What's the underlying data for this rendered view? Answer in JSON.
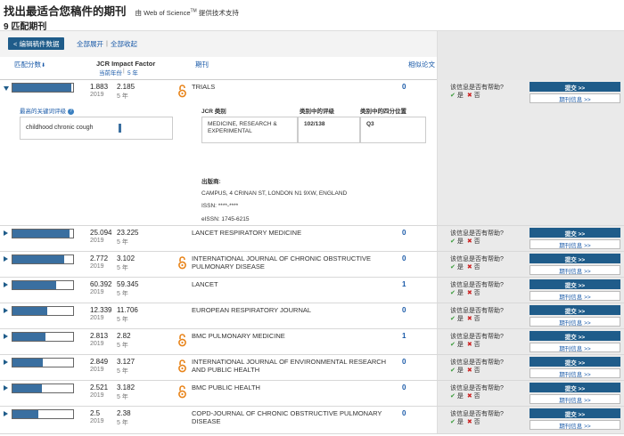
{
  "page": {
    "title": "找出最适合您稿件的期刊",
    "powered_prefix": "由 Web of Science",
    "powered_tm": "TM",
    "powered_suffix": " 提供技术支持",
    "match_count": "9 匹配期刊"
  },
  "toolbar": {
    "edit_button": "< 编辑稿件数据",
    "expand_all": "全部展开",
    "collapse_all": "全部收起",
    "sep": "|"
  },
  "header": {
    "match_score": "匹配分数",
    "jcr_if": "JCR Impact Factor",
    "current_year": "当前年份",
    "five_year": "5 年",
    "sep": "|",
    "journal": "期刊",
    "related_articles": "相似论文"
  },
  "row_labels": {
    "helpful": "该信息是否有帮助?",
    "yes": "是",
    "no": "否",
    "submit": "提交 >>",
    "journal_info": "期刊信息 >>",
    "year": "2019",
    "five_year": "5 年"
  },
  "detail": {
    "kw_title": "最高的关键词评级",
    "kw_help": "?",
    "keyword": "childhood chronic cough",
    "jcr_category_label": "JCR 类别",
    "rank_label": "类别中的评级",
    "quartile_label": "类别中的四分位置",
    "category": "MEDICINE, RESEARCH & EXPERIMENTAL",
    "rank": "102/138",
    "quartile": "Q3",
    "publisher_label": "出版商:",
    "publisher_address": "CAMPUS, 4 CRINAN ST, LONDON N1 9XW, ENGLAND",
    "issn": "ISSN: ****-****",
    "eissn": "eISSN: 1745-6215"
  },
  "colors": {
    "primary": "#1f5c8a",
    "link": "#1a5aa8",
    "bar": "#3a6fa0",
    "open_access": "#e8841a"
  },
  "journals": [
    {
      "score_fill": 0.97,
      "if_current": "1.883",
      "if_5yr": "2.185",
      "open_access": true,
      "name": "TRIALS",
      "related": "0",
      "expanded": true
    },
    {
      "score_fill": 0.94,
      "if_current": "25.094",
      "if_5yr": "23.225",
      "open_access": false,
      "name": "LANCET RESPIRATORY MEDICINE",
      "related": "0",
      "expanded": false
    },
    {
      "score_fill": 0.86,
      "if_current": "2.772",
      "if_5yr": "3.102",
      "open_access": true,
      "name": "INTERNATIONAL JOURNAL OF CHRONIC OBSTRUCTIVE PULMONARY DISEASE",
      "related": "0",
      "expanded": false
    },
    {
      "score_fill": 0.72,
      "if_current": "60.392",
      "if_5yr": "59.345",
      "open_access": false,
      "name": "LANCET",
      "related": "1",
      "expanded": false
    },
    {
      "score_fill": 0.58,
      "if_current": "12.339",
      "if_5yr": "11.706",
      "open_access": false,
      "name": "EUROPEAN RESPIRATORY JOURNAL",
      "related": "0",
      "expanded": false
    },
    {
      "score_fill": 0.55,
      "if_current": "2.813",
      "if_5yr": "2.82",
      "open_access": true,
      "name": "BMC PULMONARY MEDICINE",
      "related": "1",
      "expanded": false
    },
    {
      "score_fill": 0.5,
      "if_current": "2.849",
      "if_5yr": "3.127",
      "open_access": true,
      "name": "INTERNATIONAL JOURNAL OF ENVIRONMENTAL RESEARCH AND PUBLIC HEALTH",
      "related": "0",
      "expanded": false
    },
    {
      "score_fill": 0.48,
      "if_current": "2.521",
      "if_5yr": "3.182",
      "open_access": true,
      "name": "BMC PUBLIC HEALTH",
      "related": "0",
      "expanded": false
    },
    {
      "score_fill": 0.43,
      "if_current": "2.5",
      "if_5yr": "2.38",
      "open_access": false,
      "name": "COPD-JOURNAL OF CHRONIC OBSTRUCTIVE PULMONARY DISEASE",
      "related": "0",
      "expanded": false
    }
  ]
}
